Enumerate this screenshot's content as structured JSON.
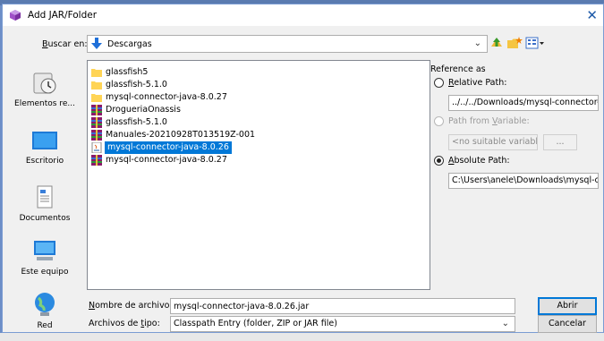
{
  "window": {
    "title": "Add JAR/Folder",
    "close_glyph": "✕"
  },
  "lookin": {
    "label_first": "B",
    "label_rest": "uscar en:",
    "current": "Descargas",
    "icons": [
      "up-one-level-icon",
      "create-new-folder-icon",
      "view-menu-icon"
    ]
  },
  "places": [
    {
      "label": "Elementos re...",
      "icon": "recent-items-icon"
    },
    {
      "label": "Escritorio",
      "icon": "desktop-icon"
    },
    {
      "label": "Documentos",
      "icon": "documents-icon"
    },
    {
      "label": "Este equipo",
      "icon": "this-pc-icon"
    },
    {
      "label": "Red",
      "icon": "network-icon"
    }
  ],
  "files": [
    {
      "name": "glassfish5",
      "type": "folder"
    },
    {
      "name": "glassfish-5.1.0",
      "type": "folder"
    },
    {
      "name": "mysql-connector-java-8.0.27",
      "type": "folder"
    },
    {
      "name": "DrogueriaOnassis",
      "type": "rar"
    },
    {
      "name": "glassfish-5.1.0",
      "type": "rar"
    },
    {
      "name": "Manuales-20210928T013519Z-001",
      "type": "rar"
    },
    {
      "name": "mysql-connector-java-8.0.26",
      "type": "jar",
      "selected": true
    },
    {
      "name": "mysql-connector-java-8.0.27",
      "type": "rar"
    }
  ],
  "reference": {
    "title": "Reference as",
    "relative": {
      "u": "R",
      "rest": "elative Path:",
      "value": "../../../Downloads/mysql-connector-"
    },
    "variable": {
      "pre": "Path from ",
      "u": "V",
      "rest": "ariable:",
      "value": "<no suitable variable>",
      "button": "..."
    },
    "absolute": {
      "u": "A",
      "rest": "bsolute Path:",
      "value": "C:\\Users\\anele\\Downloads\\mysql-conn"
    },
    "selected": "absolute"
  },
  "filename": {
    "label_pre": "N",
    "label_rest": "ombre de archivo:",
    "value": "mysql-connector-java-8.0.26.jar"
  },
  "filetype": {
    "label_pre": "Archivos de ",
    "label_u": "t",
    "label_rest": "ipo:",
    "value": "Classpath Entry (folder, ZIP or JAR file)"
  },
  "buttons": {
    "open": "Abrir",
    "cancel": "Cancelar"
  },
  "colors": {
    "selection": "#0078d7",
    "folder": "#ffd455",
    "titlebar_accent": "#1e5aa8"
  }
}
